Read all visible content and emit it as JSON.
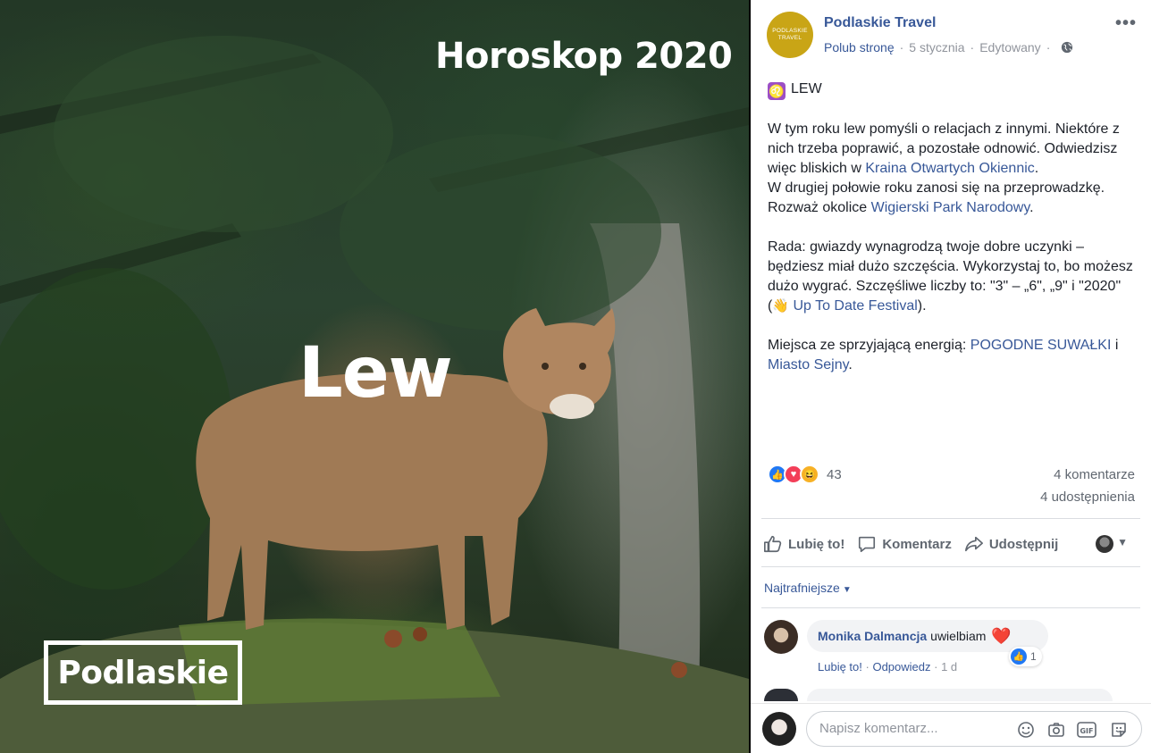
{
  "photo": {
    "title": "Horoskop 2020",
    "sign_word": "Lew",
    "brand": "Podlaskie"
  },
  "post": {
    "page_name": "Podlaskie Travel",
    "avatar_text_line1": "PODLASKIE",
    "avatar_text_line2": "TRAVEL",
    "like_page": "Polub stronę",
    "date": "5 stycznia",
    "edited": "Edytowany",
    "heading": "LEW",
    "p1_a": "W tym roku lew pomyśli o relacjach z innymi. Niektóre z nich trzeba poprawić, a pozostałe odnowić. Odwiedzisz więc bliskich w ",
    "p1_link": "Kraina Otwartych Okiennic",
    "p1_b": ".",
    "p2_a": "W drugiej połowie roku zanosi się na przeprowadzkę. Rozważ okolice ",
    "p2_link": "Wigierski Park Narodowy",
    "p2_b": ".",
    "p3_a": "Rada: gwiazdy wynagrodzą twoje dobre uczynki – będziesz miał dużo szczęścia. Wykorzystaj to, bo możesz dużo wygrać. Szczęśliwe liczby to: \"3\" – „6\", „9\" i \"2020\" (",
    "p3_emoji": "👋",
    "p3_link": "Up To Date Festival",
    "p3_b": ").",
    "p4_a": "Miejsca ze sprzyjającą energią: ",
    "p4_link1": "POGODNE SUWAŁKI",
    "p4_mid": " i ",
    "p4_link2": "Miasto Sejny",
    "p4_b": "."
  },
  "stats": {
    "reactions": "43",
    "comments": "4 komentarze",
    "shares": "4 udostępnienia"
  },
  "actions": {
    "like": "Lubię to!",
    "comment": "Komentarz",
    "share": "Udostępnij"
  },
  "comments": {
    "sort_label": "Najtrafniejsze",
    "items": [
      {
        "author": "Monika Dalmancja",
        "text": "uwielbiam",
        "emoji": "❤️",
        "like_count": "1",
        "like": "Lubię to!",
        "reply": "Odpowiedz",
        "age": "1 d"
      }
    ]
  },
  "composer": {
    "placeholder": "Napisz komentarz..."
  },
  "colors": {
    "link": "#385898",
    "muted": "#90949c",
    "brand_gold": "#c9a516",
    "like_blue": "#2078f4"
  }
}
